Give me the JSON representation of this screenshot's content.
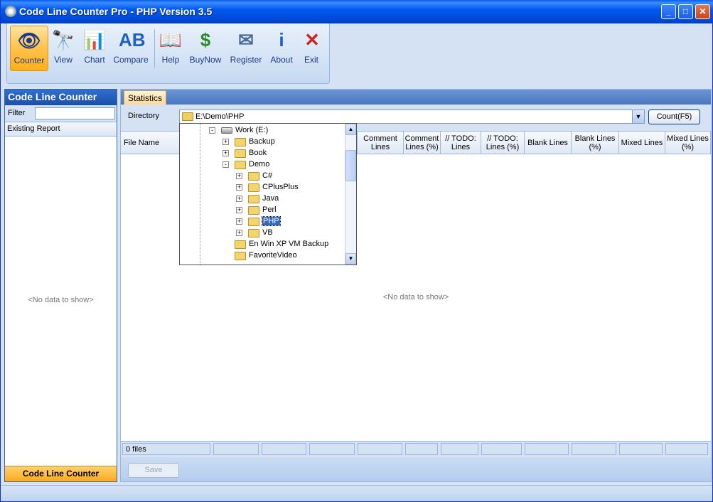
{
  "window": {
    "title": "Code Line Counter Pro - PHP Version 3.5"
  },
  "toolbar": {
    "items": [
      {
        "label": "Counter",
        "icon": "eye-icon",
        "glyph": "👁"
      },
      {
        "label": "View",
        "icon": "binoculars-icon",
        "glyph": "🔭"
      },
      {
        "label": "Chart",
        "icon": "chart-icon",
        "glyph": "📊"
      },
      {
        "label": "Compare",
        "icon": "compare-ab-icon",
        "glyph": "AB"
      },
      {
        "label": "Help",
        "icon": "book-icon",
        "glyph": "📖"
      },
      {
        "label": "BuyNow",
        "icon": "dollar-icon",
        "glyph": "$"
      },
      {
        "label": "Register",
        "icon": "mail-icon",
        "glyph": "✉"
      },
      {
        "label": "About",
        "icon": "info-icon",
        "glyph": "i"
      },
      {
        "label": "Exit",
        "icon": "exit-icon",
        "glyph": "✕"
      }
    ],
    "active": "Counter"
  },
  "left_panel": {
    "title": "Code Line Counter",
    "filter_label": "Filter",
    "filter_value": "",
    "section": "Existing Report",
    "empty": "<No data to show>",
    "footer": "Code Line Counter"
  },
  "main": {
    "tab": "Statistics",
    "directory_label": "Directory",
    "directory_value": "E:\\Demo\\PHP",
    "count_button": "Count(F5)",
    "columns": [
      "File Name",
      "Comment Lines",
      "Comment Lines (%)",
      "// TODO: Lines",
      "// TODO: Lines (%)",
      "Blank Lines",
      "Blank Lines (%)",
      "Mixed Lines",
      "Mixed Lines (%)"
    ],
    "empty": "<No data to show>",
    "status_files": "0 files",
    "save_button": "Save"
  },
  "tree": {
    "items": [
      {
        "label": "Work (E:)",
        "level": 0,
        "type": "drive",
        "expander": "-"
      },
      {
        "label": "Backup",
        "level": 1,
        "type": "folder",
        "expander": "+"
      },
      {
        "label": "Book",
        "level": 1,
        "type": "folder",
        "expander": "+"
      },
      {
        "label": "Demo",
        "level": 1,
        "type": "folder",
        "expander": "-"
      },
      {
        "label": "C#",
        "level": 2,
        "type": "folder",
        "expander": "+"
      },
      {
        "label": "CPlusPlus",
        "level": 2,
        "type": "folder",
        "expander": "+"
      },
      {
        "label": "Java",
        "level": 2,
        "type": "folder",
        "expander": "+"
      },
      {
        "label": "Perl",
        "level": 2,
        "type": "folder",
        "expander": "+"
      },
      {
        "label": "PHP",
        "level": 2,
        "type": "folder",
        "expander": "+",
        "selected": true
      },
      {
        "label": "VB",
        "level": 2,
        "type": "folder",
        "expander": "+"
      },
      {
        "label": "En Win XP VM Backup",
        "level": 1,
        "type": "folder",
        "expander": ""
      },
      {
        "label": "FavoriteVideo",
        "level": 1,
        "type": "folder",
        "expander": ""
      }
    ]
  }
}
